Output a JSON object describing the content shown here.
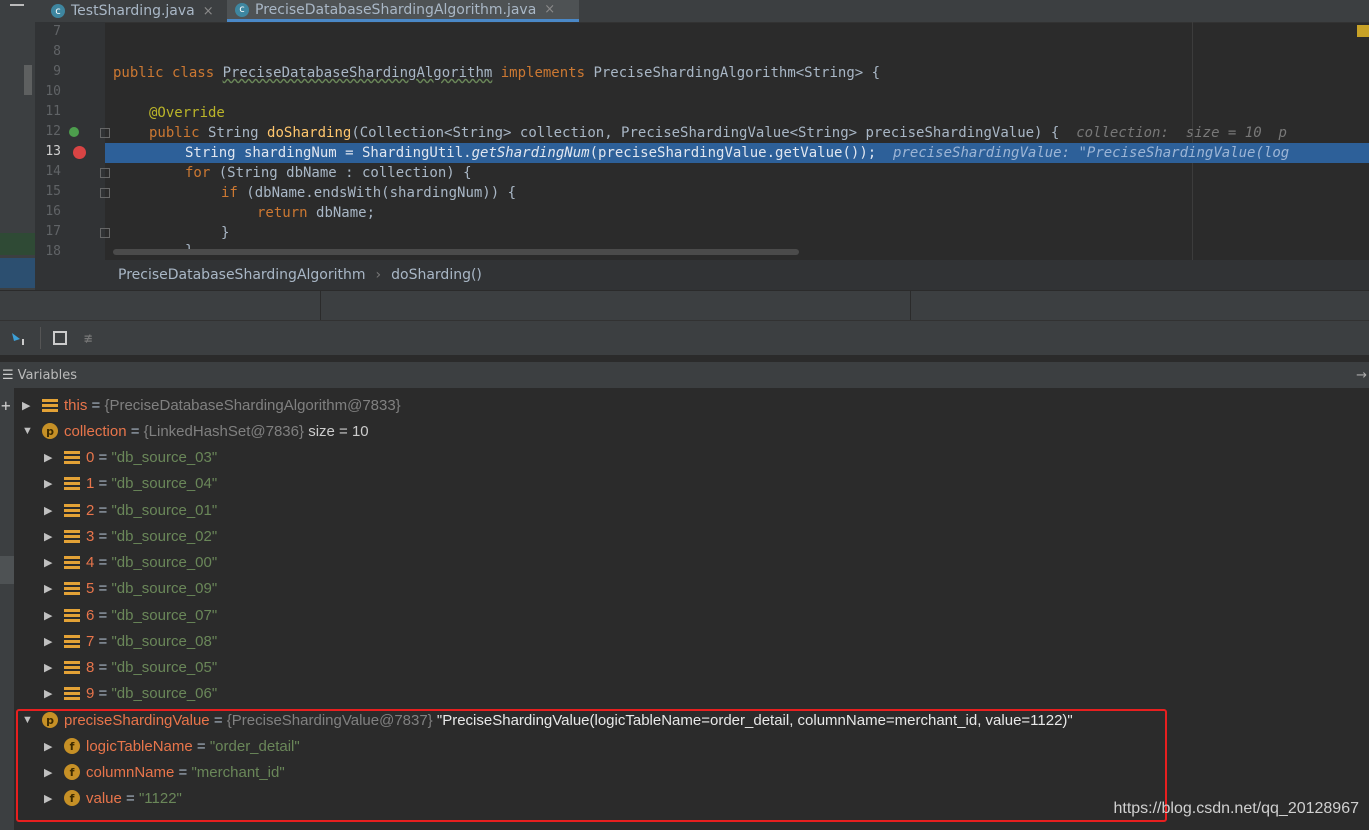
{
  "tabs": [
    {
      "label": "TestSharding.java",
      "active": false
    },
    {
      "label": "PreciseDatabaseShardingAlgorithm.java",
      "active": true
    }
  ],
  "editor": {
    "line_numbers": [
      "7",
      "8",
      "9",
      "10",
      "11",
      "12",
      "13",
      "14",
      "15",
      "16",
      "17",
      "18"
    ],
    "lines": {
      "l9_kw1": "public class ",
      "l9_cls": "PreciseDatabaseShardingAlgorithm",
      "l9_kw2": " implements ",
      "l9_rest": "PreciseShardingAlgorithm<String> {",
      "l11": "@Override",
      "l12_kw": "public ",
      "l12_type": "String ",
      "l12_fn": "doSharding",
      "l12_rest": "(Collection<String> collection, PreciseShardingValue<String> preciseShardingValue) {",
      "l12_hint": "collection:  size = 10  p",
      "l13_a": "String shardingNum = ShardingUtil.",
      "l13_it": "getShardingNum",
      "l13_b": "(preciseShardingValue.getValue());",
      "l13_hint": "preciseShardingValue: \"PreciseShardingValue(log",
      "l14_kw": "for ",
      "l14_rest": "(String dbName : collection) {",
      "l15_kw": "if ",
      "l15_rest": "(dbName.endsWith(shardingNum)) {",
      "l16_kw": "return ",
      "l16_rest": "dbName;",
      "l17": "}",
      "l18": "}"
    }
  },
  "breadcrumb": {
    "class": "PreciseDatabaseShardingAlgorithm",
    "method": "doSharding()"
  },
  "variables": {
    "title": "Variables",
    "rows": [
      {
        "name": "this",
        "type": "{PreciseDatabaseShardingAlgorithm@7833}",
        "value": "",
        "extra": ""
      },
      {
        "name": "collection",
        "type": "{LinkedHashSet@7836}",
        "value": "",
        "extra": "size = 10"
      },
      {
        "name": "0",
        "value": "\"db_source_03\""
      },
      {
        "name": "1",
        "value": "\"db_source_04\""
      },
      {
        "name": "2",
        "value": "\"db_source_01\""
      },
      {
        "name": "3",
        "value": "\"db_source_02\""
      },
      {
        "name": "4",
        "value": "\"db_source_00\""
      },
      {
        "name": "5",
        "value": "\"db_source_09\""
      },
      {
        "name": "6",
        "value": "\"db_source_07\""
      },
      {
        "name": "7",
        "value": "\"db_source_08\""
      },
      {
        "name": "8",
        "value": "\"db_source_05\""
      },
      {
        "name": "9",
        "value": "\"db_source_06\""
      },
      {
        "name": "preciseShardingValue",
        "type": "{PreciseShardingValue@7837}",
        "value": "",
        "extra": "\"PreciseShardingValue(logicTableName=order_detail, columnName=merchant_id, value=1122)\""
      },
      {
        "name": "logicTableName",
        "value": "\"order_detail\""
      },
      {
        "name": "columnName",
        "value": "\"merchant_id\""
      },
      {
        "name": "value",
        "value": "\"1122\""
      }
    ]
  },
  "watermark": "https://blog.csdn.net/qq_20128967",
  "icons": {
    "eq": "=",
    "p_badge": "p",
    "f_badge": "f",
    "c_badge": "c"
  }
}
